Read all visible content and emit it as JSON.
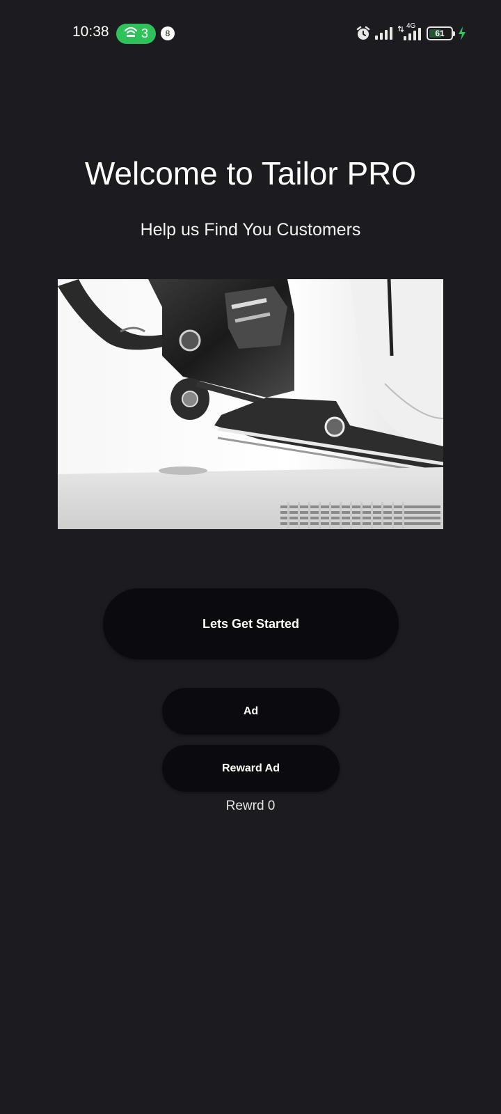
{
  "status_bar": {
    "time": "10:38",
    "hotspot_count": "3",
    "notification_count": "8",
    "network_label": "4G",
    "battery_level": "61",
    "battery_fraction": 0.61,
    "icons": [
      "hotspot-icon",
      "alarm-icon",
      "signal-icon",
      "signal-4g-icon",
      "battery-icon",
      "charging-icon"
    ],
    "colors": {
      "hotspot_pill": "#2fc25b",
      "charging": "#2fc25b"
    }
  },
  "main": {
    "title": "Welcome to Tailor PRO",
    "subtitle": "Help us Find You Customers",
    "hero_image": "sewing-machine-presser-foot-photo",
    "start_button_label": "Lets Get Started",
    "ad_button_label": "Ad",
    "reward_ad_button_label": "Reward Ad",
    "reward_text": "Rewrd 0"
  },
  "theme": {
    "background": "#1c1b20",
    "button_background": "#0b0a0e",
    "text": "#ffffff"
  }
}
